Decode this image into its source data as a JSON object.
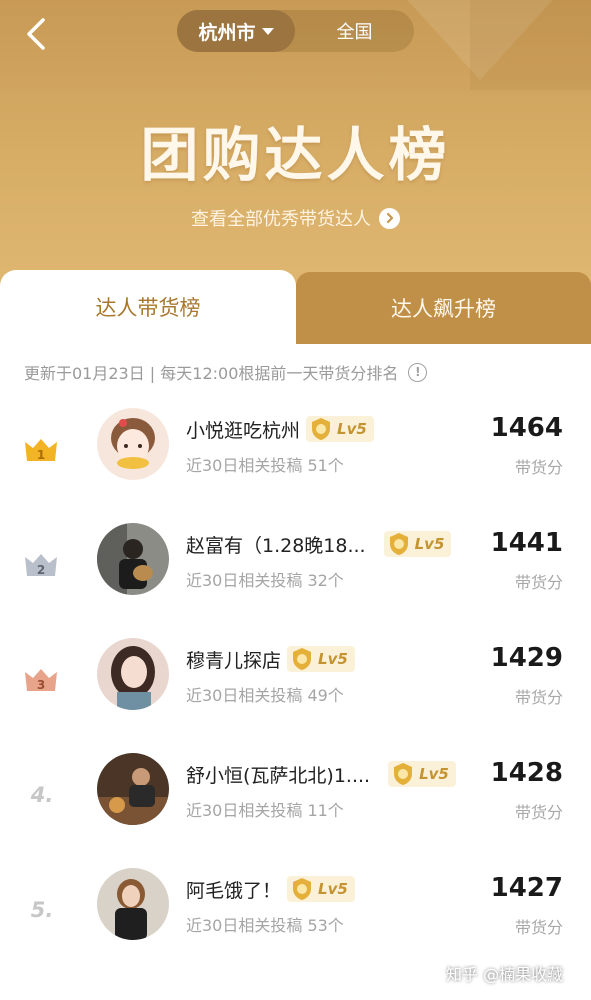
{
  "header": {
    "city_label": "杭州市",
    "nation_label": "全国",
    "title": "团购达人榜",
    "link_text": "查看全部优秀带货达人"
  },
  "tabs": [
    {
      "label": "达人带货榜",
      "active": true
    },
    {
      "label": "达人飙升榜",
      "active": false
    }
  ],
  "update_note": "更新于01月23日 | 每天12:00根据前一天带货分排名",
  "colors": {
    "brand_gold": "#c8984f",
    "tab_active_text": "#a8782f",
    "badge_text": "#c49332",
    "badge_bg": "#fbf1d8",
    "rank1": "#f2b324",
    "rank2": "#b9c0cc",
    "rank3": "#e8a48a"
  },
  "score_label": "带货分",
  "rankings": [
    {
      "rank": "1",
      "rank_style": "gold-crown-icon",
      "name": "小悦逛吃杭州",
      "level": "Lv5",
      "posts": "近30日相关投稿 51个",
      "score": "1464"
    },
    {
      "rank": "2",
      "rank_style": "silver-crown-icon",
      "name": "赵富有（1.28晚18...",
      "level": "Lv5",
      "posts": "近30日相关投稿 32个",
      "score": "1441"
    },
    {
      "rank": "3",
      "rank_style": "bronze-crown-icon",
      "name": "穆青儿探店",
      "level": "Lv5",
      "posts": "近30日相关投稿 49个",
      "score": "1429"
    },
    {
      "rank": "4.",
      "rank_style": "plain",
      "name": "舒小恒(瓦萨北北)1....",
      "level": "Lv5",
      "posts": "近30日相关投稿 11个",
      "score": "1428"
    },
    {
      "rank": "5.",
      "rank_style": "plain",
      "name": "阿毛饿了！",
      "level": "Lv5",
      "posts": "近30日相关投稿 53个",
      "score": "1427"
    }
  ],
  "watermark": "知乎 @楠果收藏"
}
